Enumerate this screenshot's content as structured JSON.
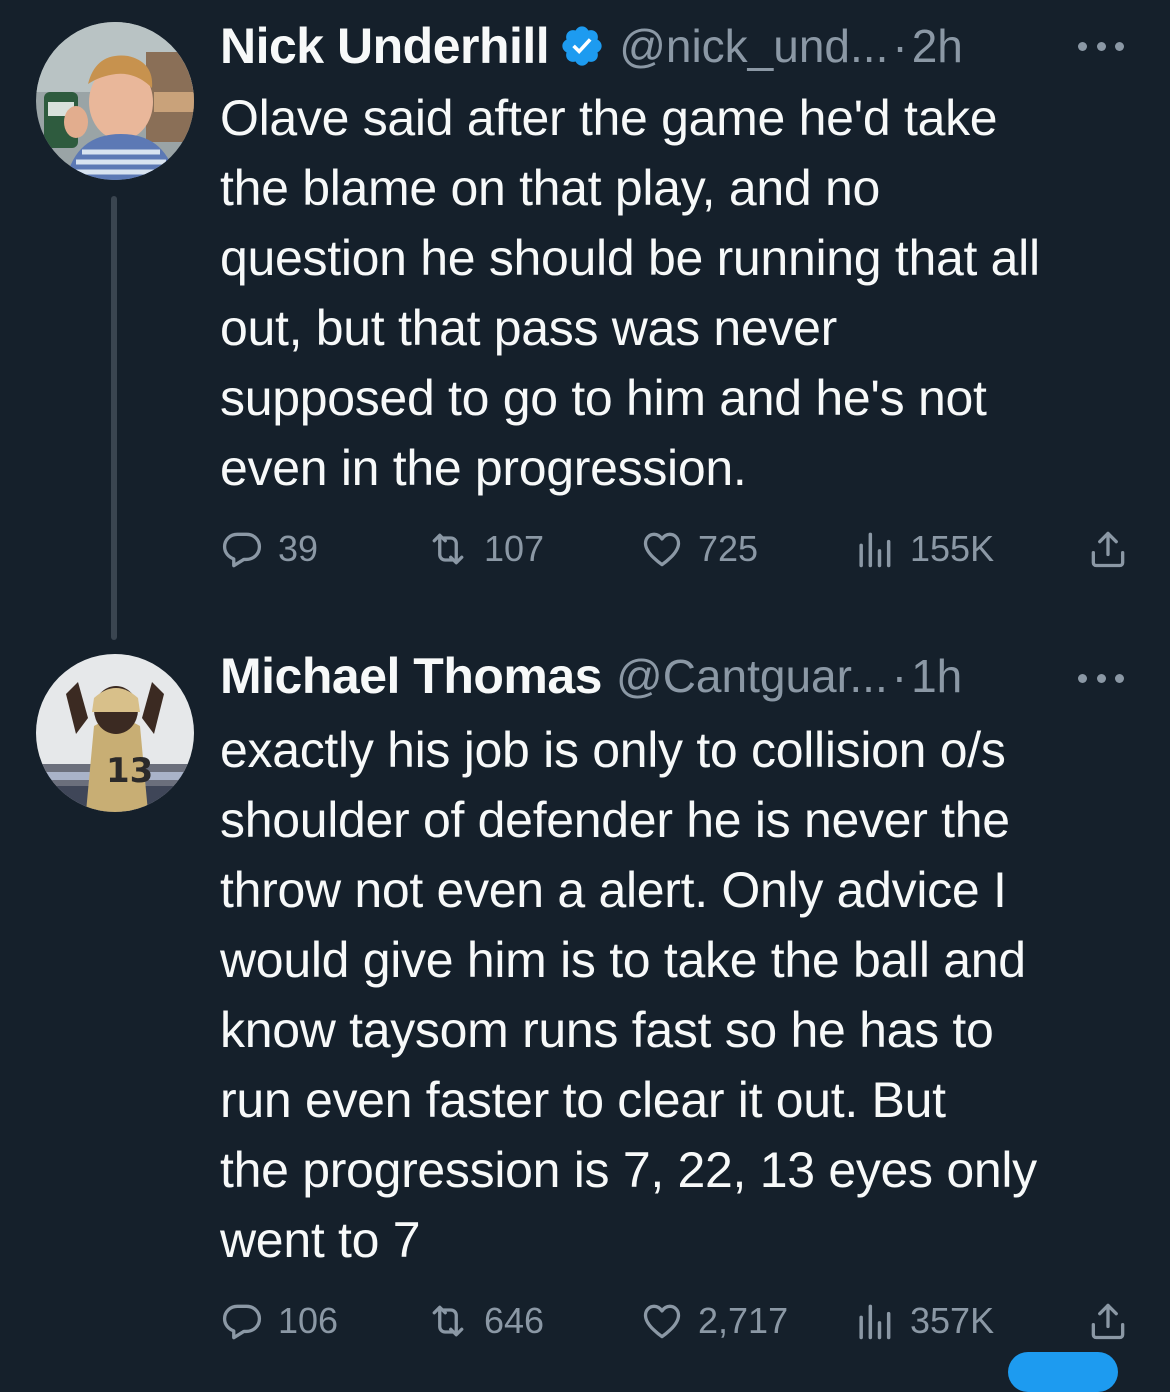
{
  "tweets": [
    {
      "name": "Nick Underhill",
      "handle": "@nick_und...",
      "separator": "·",
      "time": "2h",
      "verified": true,
      "text": "Olave said after the game he'd take\nthe blame on that play, and no\nquestion he should be running that all\nout, but that pass was never\nsupposed to go to him and he's not\neven in the progression.",
      "replies": "39",
      "retweets": "107",
      "likes": "725",
      "views": "155K"
    },
    {
      "name": "Michael Thomas",
      "handle": "@Cantguar...",
      "separator": "·",
      "time": "1h",
      "verified": false,
      "text": "exactly his job is only to collision o/s\nshoulder of defender he is never the\nthrow not even a alert. Only advice I\nwould give him is to take the ball and\nknow taysom runs fast so he has to\nrun even faster to clear it out. But\nthe progression is 7, 22, 13 eyes only\nwent to 7",
      "replies": "106",
      "retweets": "646",
      "likes": "2,717",
      "views": "357K"
    }
  ],
  "icons": {
    "verified": "verified-badge-icon",
    "more": "more-horizontal-icon",
    "reply": "reply-icon",
    "retweet": "retweet-icon",
    "like": "heart-icon",
    "views": "views-chart-icon",
    "share": "share-icon"
  },
  "colors": {
    "background": "#15202b",
    "primary_text": "#f7f9f9",
    "secondary_text": "#8b98a5",
    "verified_blue": "#1d9bf0"
  }
}
